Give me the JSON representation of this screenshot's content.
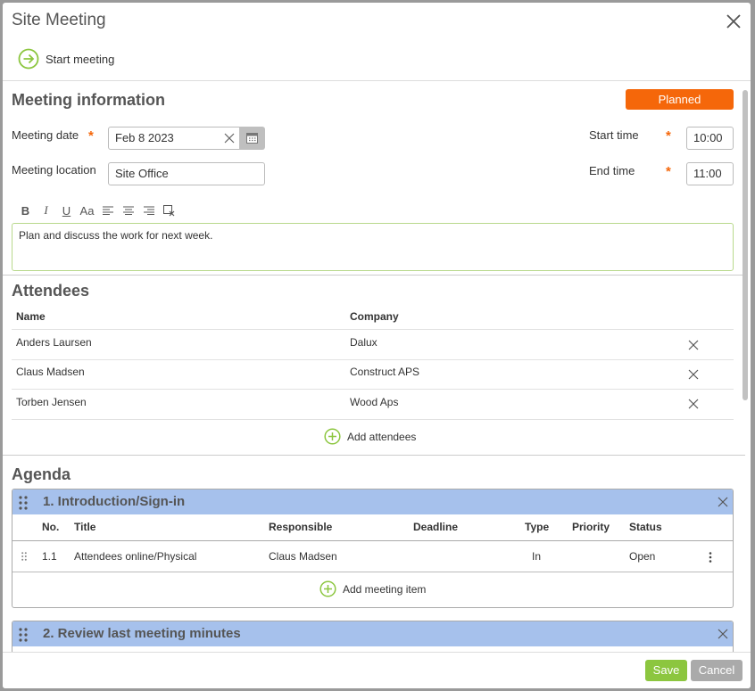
{
  "dialog": {
    "title": "Site Meeting",
    "start_meeting_label": "Start meeting"
  },
  "meeting_info": {
    "section_title": "Meeting information",
    "status": "Planned",
    "date_label": "Meeting date",
    "date_value": "Feb 8 2023",
    "location_label": "Meeting location",
    "location_value": "Site Office",
    "start_label": "Start time",
    "start_value": "10:00",
    "end_label": "End time",
    "end_value": "11:00",
    "required_mark": "*",
    "description": "Plan and discuss the work for next week."
  },
  "toolbar": {
    "bold": "B",
    "italic": "I",
    "underline": "U",
    "font_size": "Aa"
  },
  "attendees": {
    "section_title": "Attendees",
    "col_name": "Name",
    "col_company": "Company",
    "rows": [
      {
        "name": "Anders Laursen",
        "company": "Dalux"
      },
      {
        "name": "Claus Madsen",
        "company": "Construct APS"
      },
      {
        "name": "Torben Jensen",
        "company": "Wood Aps"
      }
    ],
    "add_label": "Add attendees"
  },
  "agenda": {
    "section_title": "Agenda",
    "groups": [
      {
        "title": "1. Introduction/Sign-in",
        "columns": {
          "no": "No.",
          "title": "Title",
          "responsible": "Responsible",
          "deadline": "Deadline",
          "type": "Type",
          "priority": "Priority",
          "status": "Status"
        },
        "items": [
          {
            "no": "1.1",
            "title": "Attendees online/Physical",
            "responsible": "Claus Madsen",
            "deadline": "",
            "type": "In",
            "priority": "",
            "status": "Open"
          }
        ],
        "add_label": "Add meeting item"
      },
      {
        "title": "2. Review last meeting minutes"
      }
    ]
  },
  "footer": {
    "save": "Save",
    "cancel": "Cancel"
  },
  "colors": {
    "accent_green": "#8cc63f",
    "status_orange": "#f5670a",
    "agenda_header": "#a6c1ec"
  }
}
